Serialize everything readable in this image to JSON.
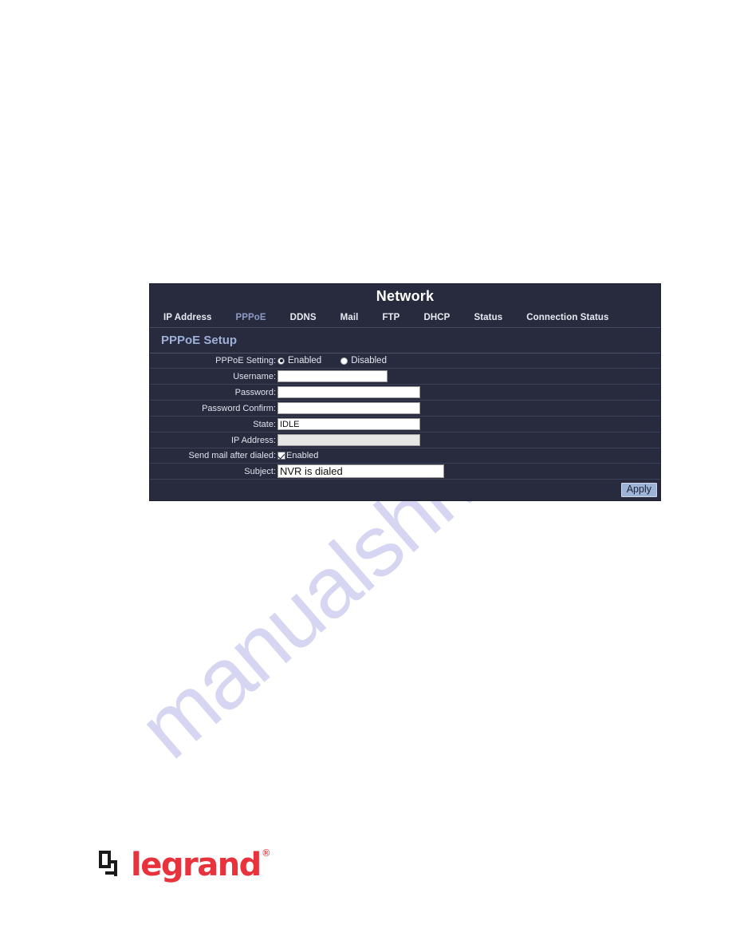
{
  "page": {
    "background_color": "#ffffff",
    "watermark_text": "manualshive.com"
  },
  "panel": {
    "title": "Network",
    "accent_color": "#8d9bc4",
    "background_color": "#272b3d",
    "tabs": [
      {
        "label": "IP Address",
        "active": false
      },
      {
        "label": "PPPoE",
        "active": true
      },
      {
        "label": "DDNS",
        "active": false
      },
      {
        "label": "Mail",
        "active": false
      },
      {
        "label": "FTP",
        "active": false
      },
      {
        "label": "DHCP",
        "active": false
      },
      {
        "label": "Status",
        "active": false
      },
      {
        "label": "Connection Status",
        "active": false
      }
    ],
    "section_title": "PPPoE Setup",
    "form": {
      "pppoe_setting": {
        "label": "PPPoE Setting:",
        "option_enabled": "Enabled",
        "option_disabled": "Disabled",
        "selected": "Enabled"
      },
      "username": {
        "label": "Username:",
        "value": ""
      },
      "password": {
        "label": "Password:",
        "value": ""
      },
      "password_confirm": {
        "label": "Password Confirm:",
        "value": ""
      },
      "state": {
        "label": "State:",
        "value": "IDLE"
      },
      "ip_address": {
        "label": "IP Address:",
        "value": ""
      },
      "send_mail": {
        "label": "Send mail after dialed:",
        "checkbox_label": "Enabled",
        "checked": true
      },
      "subject": {
        "label": "Subject:",
        "value": "NVR is dialed"
      }
    },
    "apply_label": "Apply"
  },
  "brand": {
    "name": "legrand",
    "registered_mark": "®",
    "color": "#e8323c"
  }
}
